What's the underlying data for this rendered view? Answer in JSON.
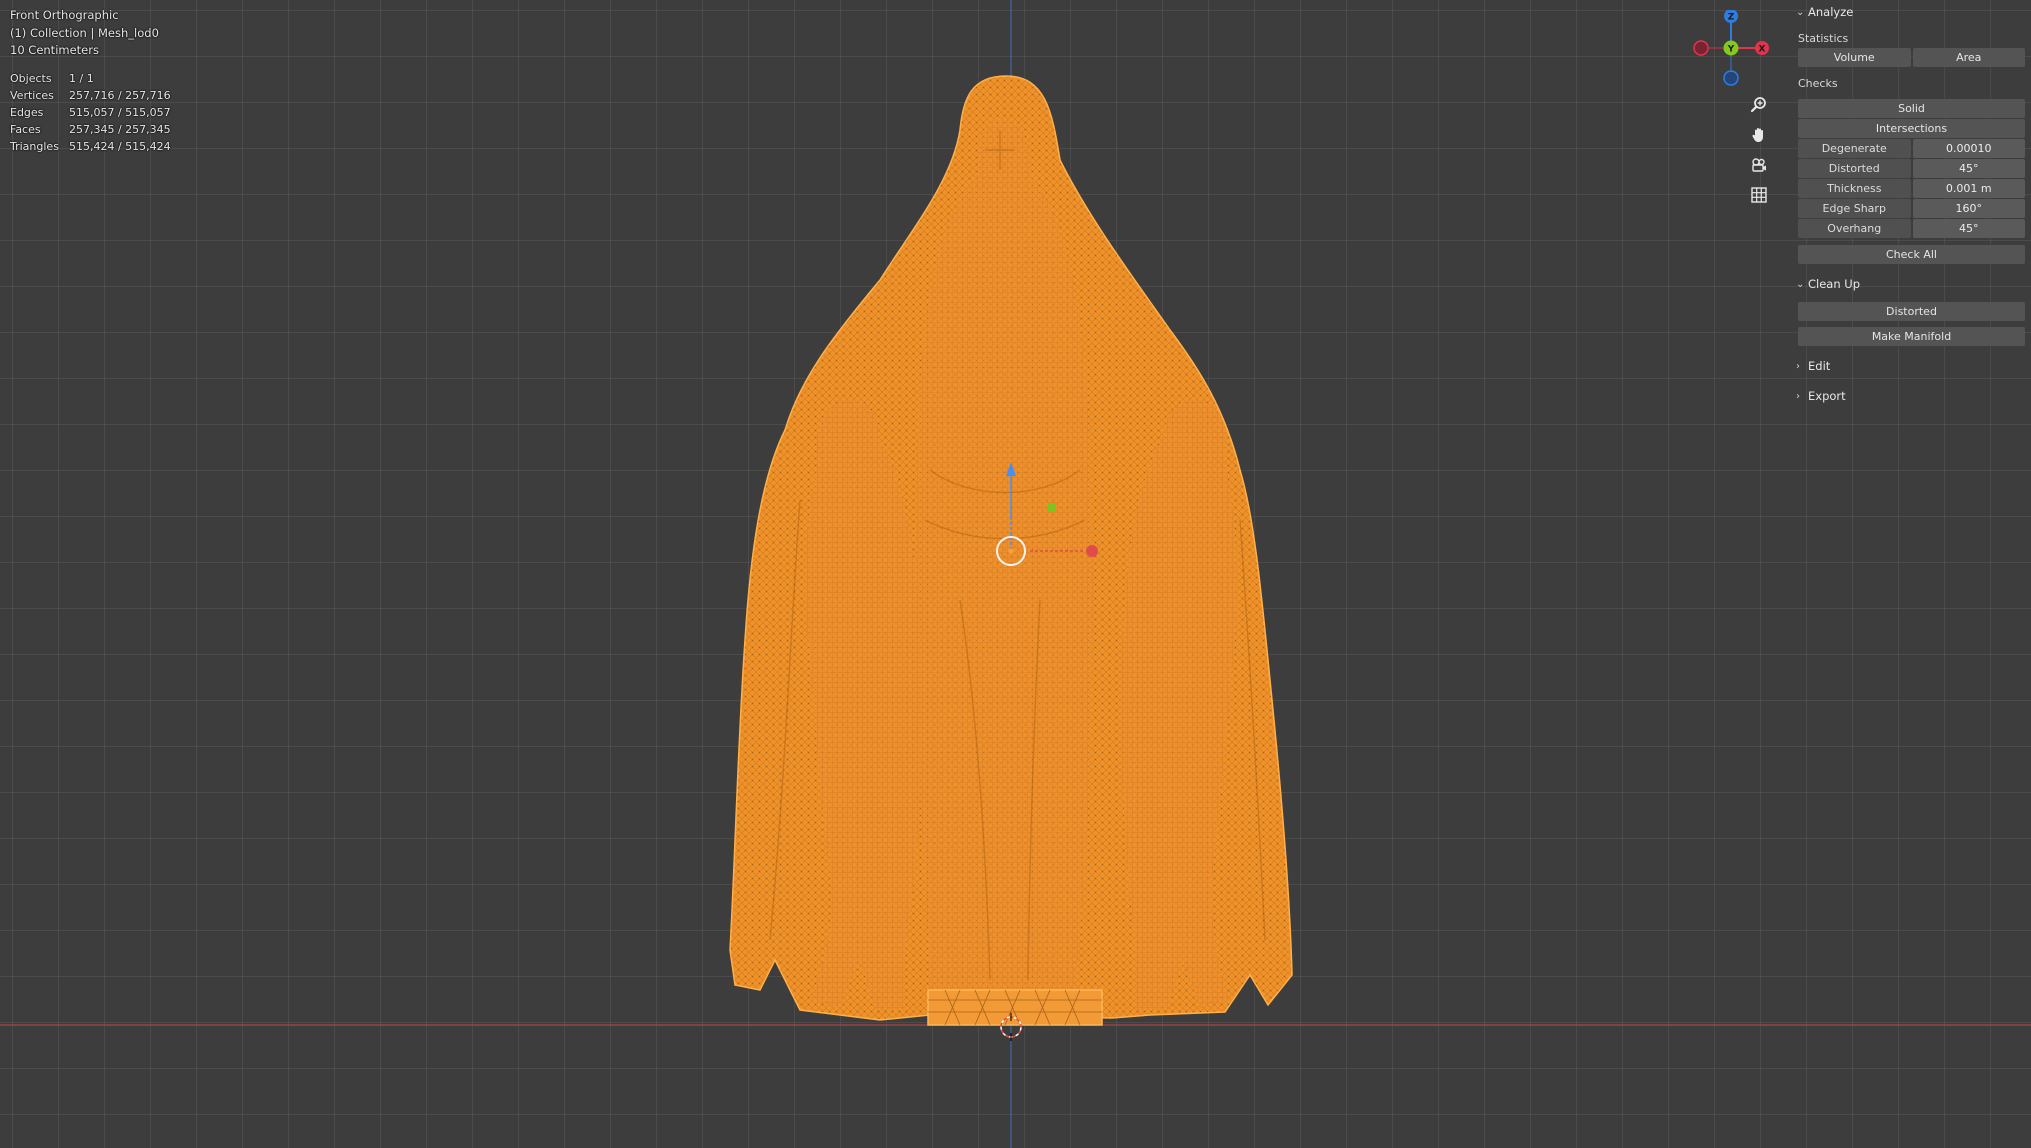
{
  "viewport": {
    "view_name": "Front Orthographic",
    "collection": "(1) Collection | Mesh_lod0",
    "grid_scale": "10 Centimeters",
    "stats": [
      {
        "label": "Objects",
        "value": "1 / 1"
      },
      {
        "label": "Vertices",
        "value": "257,716 / 257,716"
      },
      {
        "label": "Edges",
        "value": "515,057 / 515,057"
      },
      {
        "label": "Faces",
        "value": "257,345 / 257,345"
      },
      {
        "label": "Triangles",
        "value": "515,424 / 515,424"
      }
    ],
    "selection_color": "#f2952c",
    "background_color": "#3d3d3d"
  },
  "gizmo": {
    "x_label": "X",
    "y_label": "Y",
    "z_label": "Z",
    "x_color": "#e0344e",
    "y_color": "#86c81e",
    "z_color": "#2d7de1"
  },
  "nav_tools": {
    "zoom_icon": "zoom-icon",
    "pan_icon": "hand-icon",
    "camera_icon": "camera-icon",
    "ortho_icon": "grid-icon"
  },
  "sidebar": {
    "analyze": {
      "title": "Analyze",
      "statistics_label": "Statistics",
      "volume_btn": "Volume",
      "area_btn": "Area",
      "checks_label": "Checks",
      "solid_btn": "Solid",
      "intersections_btn": "Intersections",
      "props": [
        {
          "label": "Degenerate",
          "value": "0.00010"
        },
        {
          "label": "Distorted",
          "value": "45°"
        },
        {
          "label": "Thickness",
          "value": "0.001 m"
        },
        {
          "label": "Edge Sharp",
          "value": "160°"
        },
        {
          "label": "Overhang",
          "value": "45°"
        }
      ],
      "check_all_btn": "Check All"
    },
    "cleanup": {
      "title": "Clean Up",
      "distorted_btn": "Distorted",
      "make_manifold_btn": "Make Manifold"
    },
    "edit": {
      "title": "Edit"
    },
    "export": {
      "title": "Export"
    }
  }
}
